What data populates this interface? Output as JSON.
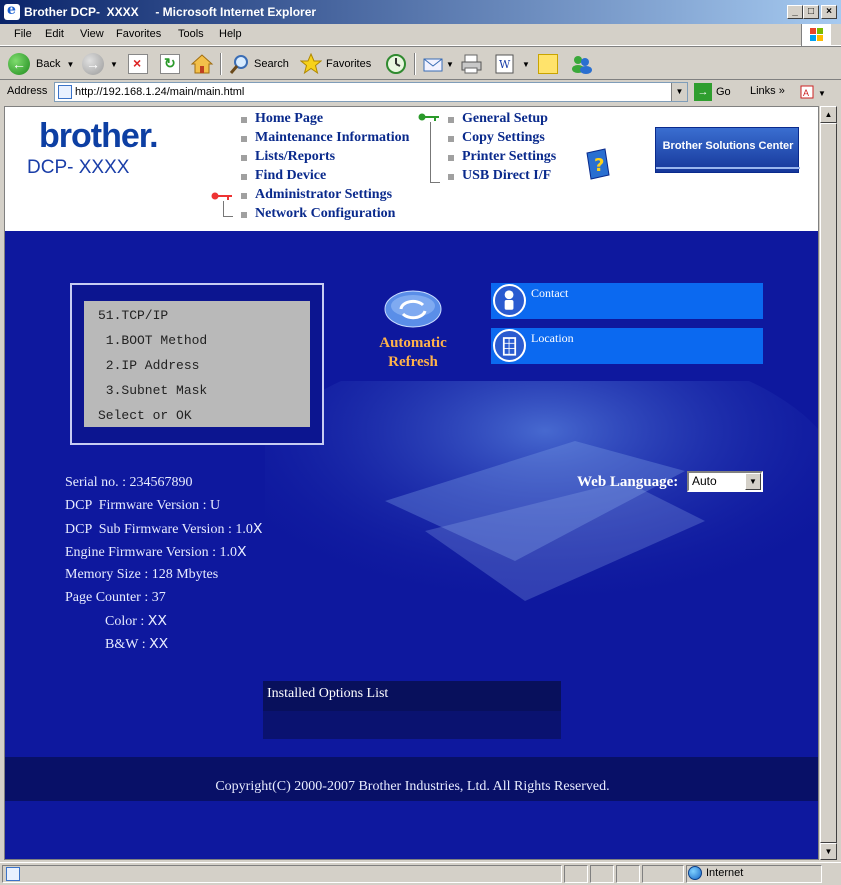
{
  "window": {
    "title": "Brother DCP-  XXXX     - Microsoft Internet Explorer",
    "controls": [
      "_",
      "□",
      "×"
    ]
  },
  "menu": [
    "File",
    "Edit",
    "View",
    "Favorites",
    "Tools",
    "Help"
  ],
  "toolbar": {
    "back_label": "Back",
    "search_label": "Search",
    "favorites_label": "Favorites"
  },
  "address": {
    "label": "Address",
    "url": "http://192.168.1.24/main/main.html",
    "go_label": "Go",
    "links_label": "Links"
  },
  "header": {
    "brand": "brother.",
    "model": "DCP- XXXX",
    "nav_left": [
      "Home Page",
      "Maintenance Information",
      "Lists/Reports",
      "Find Device",
      "Administrator Settings",
      "Network Configuration"
    ],
    "nav_right": [
      "General Setup",
      "Copy Settings",
      "Printer Settings",
      "USB Direct I/F"
    ],
    "solutions_label": "Brother Solutions Center",
    "icons": [
      "key-icon",
      "help-book-icon"
    ]
  },
  "lcd": {
    "lines": [
      "51.TCP/IP",
      " 1.BOOT Method",
      " 2.IP Address",
      " 3.Subnet Mask",
      "Select or OK"
    ]
  },
  "refresh": {
    "line1": "Automatic",
    "line2": "Refresh"
  },
  "contact": {
    "label": "Contact"
  },
  "location": {
    "label": "Location"
  },
  "device_info": {
    "serial": "Serial no. : 234567890",
    "firmware": "DCP  Firmware Version : U",
    "sub_firmware": "DCP  Sub Firmware Version : 1.0Ⅹ",
    "engine_firmware": "Engine Firmware Version : 1.0Ⅹ",
    "memory": "Memory Size : 128 Mbytes",
    "page_counter": "Page Counter : 37",
    "color": "Color : ⅩⅩ",
    "bw": "B&W : ⅩⅩ"
  },
  "web_language": {
    "label": "Web Language:",
    "selected": "Auto"
  },
  "installed_options": {
    "title": "Installed Options List"
  },
  "footer": {
    "copyright": "Copyright(C) 2000-2007 Brother Industries, Ltd. All Rights Reserved."
  },
  "statusbar": {
    "zone": "Internet"
  },
  "colors": {
    "main_bg": "#0e189e",
    "nav_text": "#0a2a8c",
    "refresh_text": "#ffb24a",
    "info_box": "#0b69f0"
  }
}
